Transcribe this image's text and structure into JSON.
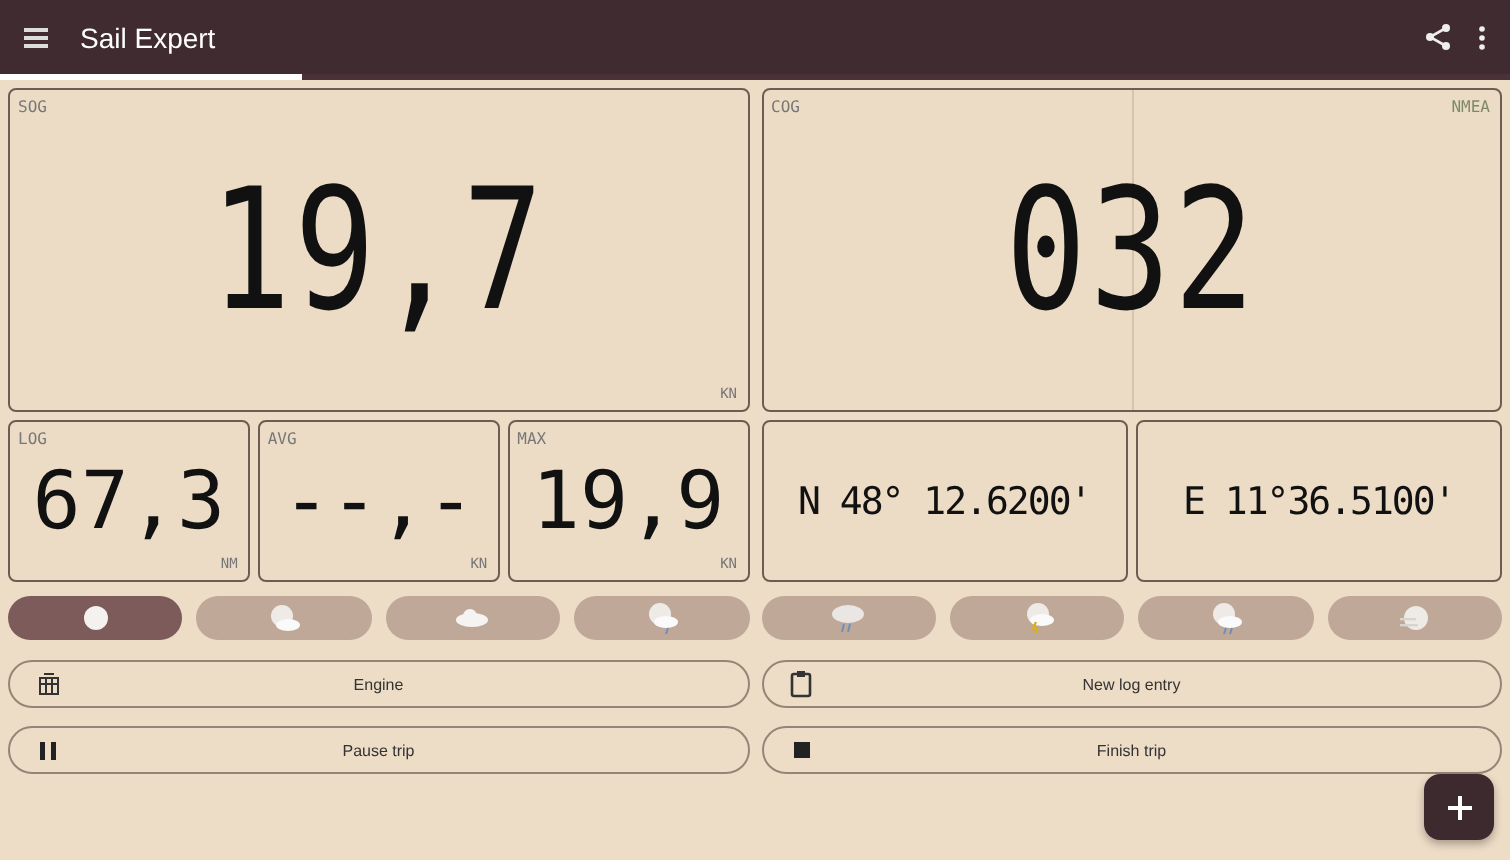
{
  "app_bar": {
    "title": "Sail Expert"
  },
  "main_displays": [
    {
      "label": "SOG",
      "value": "19,7",
      "unit": "KN"
    },
    {
      "label": "COG",
      "value": "032",
      "tag": "NMEA"
    }
  ],
  "small_displays": [
    {
      "label": "LOG",
      "value": "67,3",
      "unit": "NM"
    },
    {
      "label": "AVG",
      "value": "--,-",
      "unit": "KN"
    },
    {
      "label": "MAX",
      "value": "19,9",
      "unit": "KN"
    }
  ],
  "position": [
    {
      "value": "N 48° 12.6200'"
    },
    {
      "value": "E 11°36.5100'"
    }
  ],
  "weather": [
    {
      "kind": "sun",
      "selected": true
    },
    {
      "kind": "partly-cloudy",
      "selected": false
    },
    {
      "kind": "cloud",
      "selected": false
    },
    {
      "kind": "drizzle",
      "selected": false
    },
    {
      "kind": "rain",
      "selected": false
    },
    {
      "kind": "thunder",
      "selected": false
    },
    {
      "kind": "sleet",
      "selected": false
    },
    {
      "kind": "fog",
      "selected": false
    }
  ],
  "actions": [
    {
      "kind": "engine",
      "label": "Engine"
    },
    {
      "kind": "log",
      "label": "New log entry"
    },
    {
      "kind": "pause",
      "label": "Pause trip"
    },
    {
      "kind": "stop",
      "label": "Finish trip"
    }
  ]
}
